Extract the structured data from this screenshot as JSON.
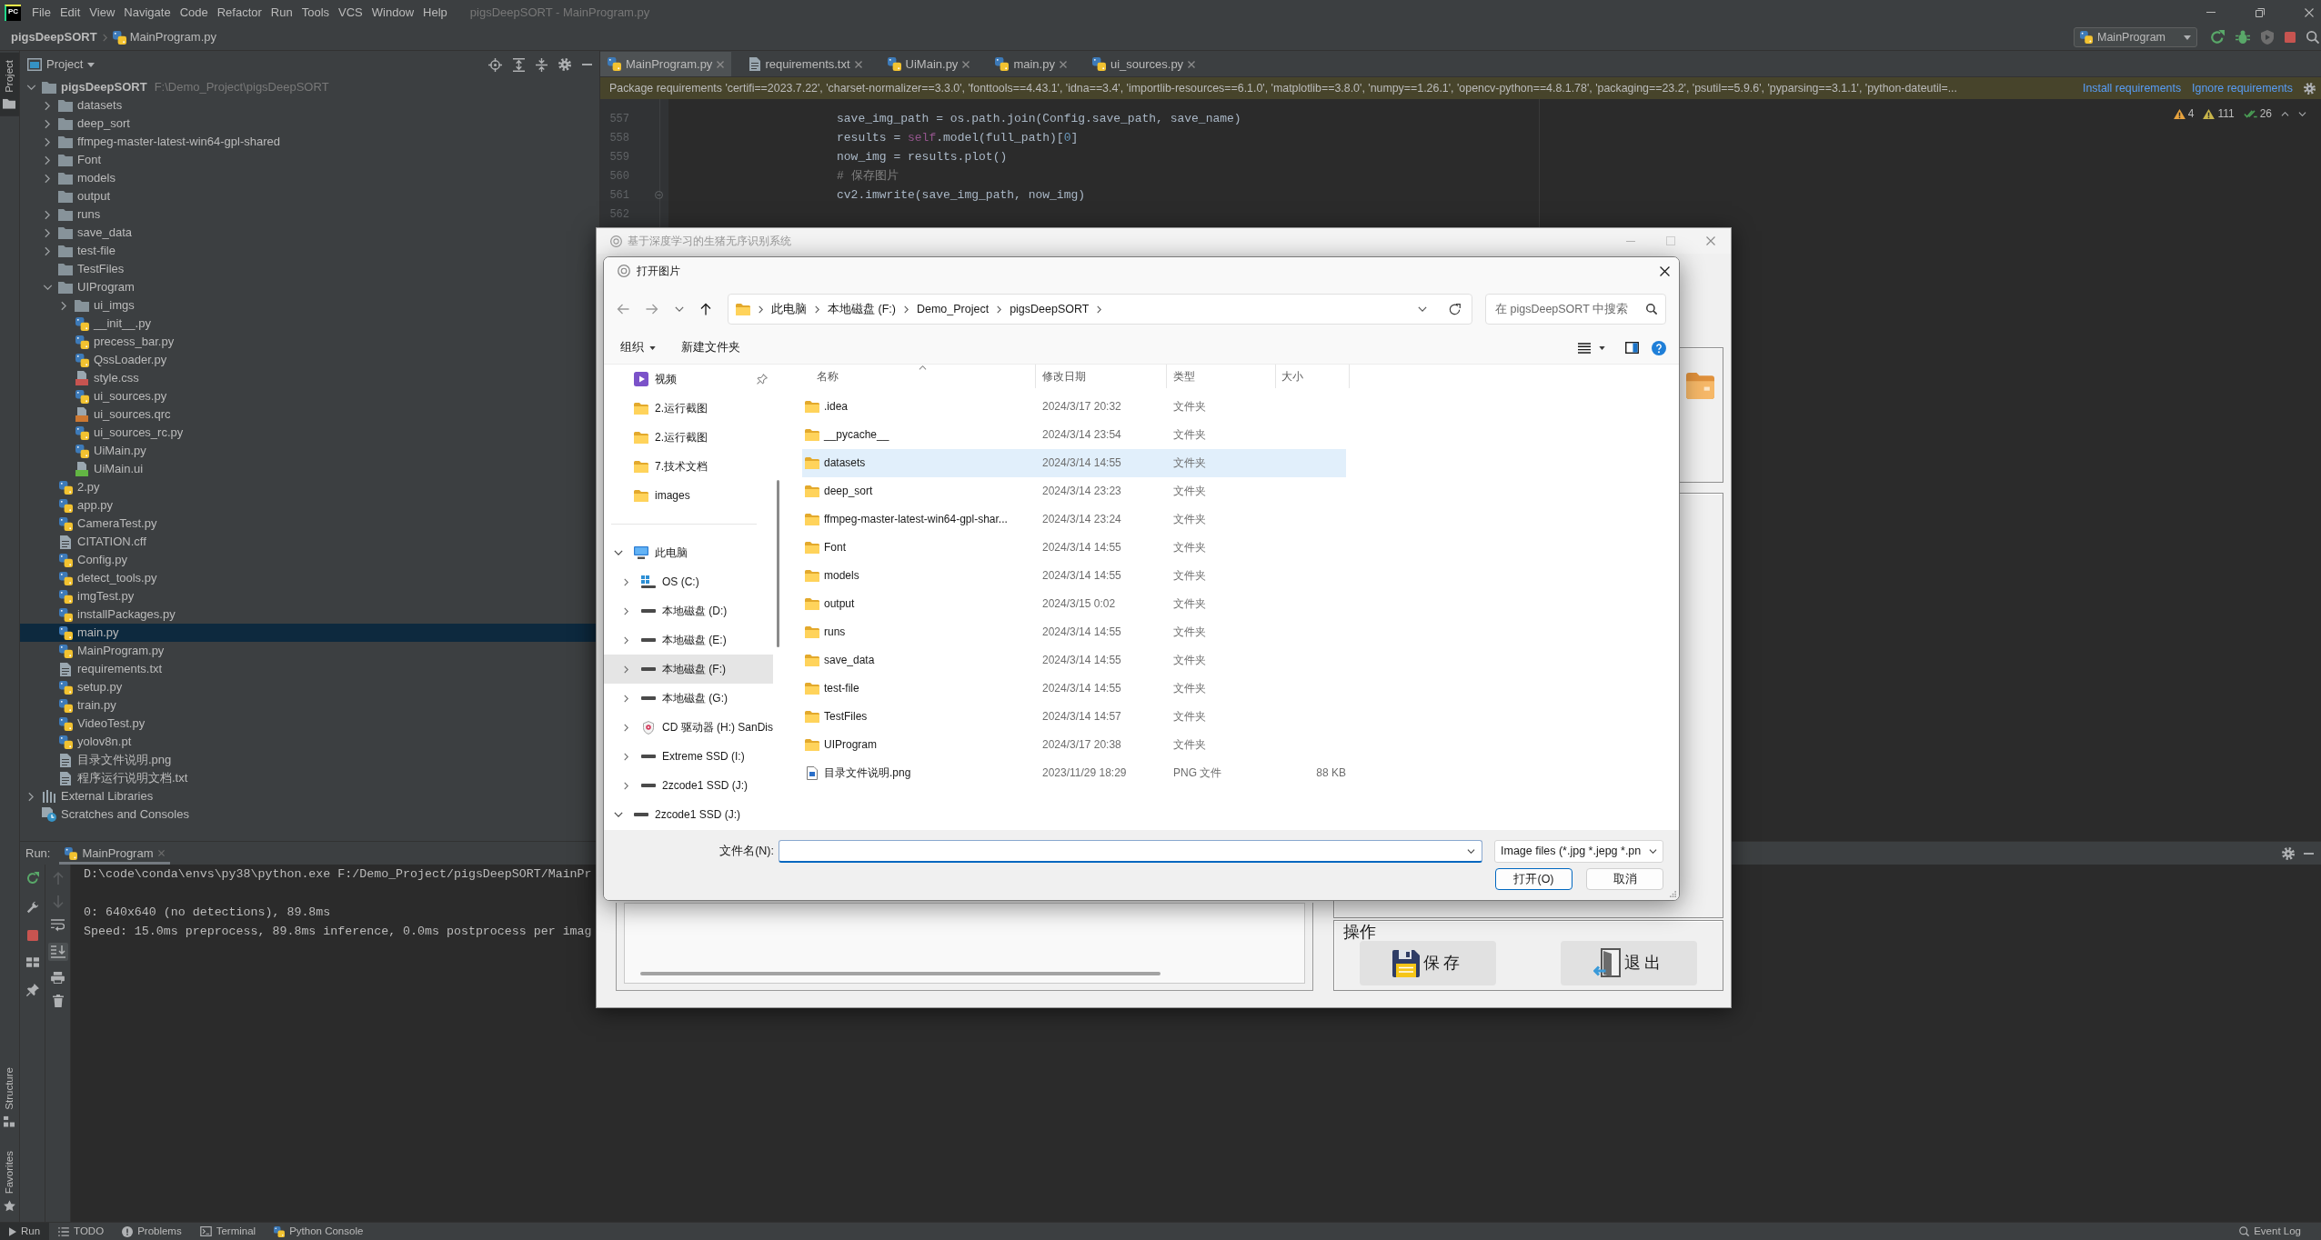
{
  "ide": {
    "logo": "PC",
    "menu": [
      "File",
      "Edit",
      "View",
      "Navigate",
      "Code",
      "Refactor",
      "Run",
      "Tools",
      "VCS",
      "Window",
      "Help"
    ],
    "title": "pigsDeepSORT - MainProgram.py",
    "breadcrumb": [
      {
        "label": "pigsDeepSORT",
        "kind": "project"
      },
      {
        "label": "MainProgram.py",
        "kind": "python"
      }
    ],
    "run_config": "MainProgram",
    "side_tabs_top": [
      {
        "label": "Project",
        "kind": "project",
        "selected": true
      }
    ],
    "side_tabs_bottom": [
      {
        "label": "Structure",
        "kind": "structure",
        "selected": false
      },
      {
        "label": "Favorites",
        "kind": "favorites",
        "selected": false
      }
    ],
    "project": {
      "title": "Project",
      "tree": [
        {
          "label": "pigsDeepSORT",
          "path": "F:\\Demo_Project\\pigsDeepSORT",
          "kind": "folder",
          "expanded": true,
          "selected": false,
          "children": [
            {
              "label": "datasets",
              "kind": "folder",
              "expanded": false,
              "selected": false
            },
            {
              "label": "deep_sort",
              "kind": "folder",
              "expanded": false,
              "selected": false
            },
            {
              "label": "ffmpeg-master-latest-win64-gpl-shared",
              "kind": "folder",
              "expanded": false,
              "selected": false
            },
            {
              "label": "Font",
              "kind": "folder",
              "expanded": false,
              "selected": false
            },
            {
              "label": "models",
              "kind": "folder",
              "expanded": false,
              "selected": false
            },
            {
              "label": "output",
              "kind": "folder",
              "selected": false
            },
            {
              "label": "runs",
              "kind": "folder",
              "expanded": false,
              "selected": false
            },
            {
              "label": "save_data",
              "kind": "folder",
              "expanded": false,
              "selected": false
            },
            {
              "label": "test-file",
              "kind": "folder",
              "expanded": false,
              "selected": false
            },
            {
              "label": "TestFiles",
              "kind": "folder",
              "selected": false
            },
            {
              "label": "UIProgram",
              "kind": "folder",
              "expanded": true,
              "selected": false,
              "children": [
                {
                  "label": "ui_imgs",
                  "kind": "folder",
                  "expanded": false,
                  "selected": false
                },
                {
                  "label": "__init__.py",
                  "kind": "python",
                  "selected": false
                },
                {
                  "label": "precess_bar.py",
                  "kind": "python",
                  "selected": false
                },
                {
                  "label": "QssLoader.py",
                  "kind": "python",
                  "selected": false
                },
                {
                  "label": "style.css",
                  "kind": "css",
                  "selected": false
                },
                {
                  "label": "ui_sources.py",
                  "kind": "python",
                  "selected": false
                },
                {
                  "label": "ui_sources.qrc",
                  "kind": "qrc",
                  "selected": false
                },
                {
                  "label": "ui_sources_rc.py",
                  "kind": "python",
                  "selected": false
                },
                {
                  "label": "UiMain.py",
                  "kind": "python",
                  "selected": false
                },
                {
                  "label": "UiMain.ui",
                  "kind": "ui",
                  "selected": false
                }
              ]
            },
            {
              "label": "2.py",
              "kind": "python",
              "selected": false
            },
            {
              "label": "app.py",
              "kind": "python",
              "selected": false
            },
            {
              "label": "CameraTest.py",
              "kind": "python",
              "selected": false
            },
            {
              "label": "CITATION.cff",
              "kind": "text",
              "selected": false
            },
            {
              "label": "Config.py",
              "kind": "python",
              "selected": false
            },
            {
              "label": "detect_tools.py",
              "kind": "python",
              "selected": false
            },
            {
              "label": "imgTest.py",
              "kind": "python",
              "selected": false
            },
            {
              "label": "installPackages.py",
              "kind": "python",
              "selected": false
            },
            {
              "label": "main.py",
              "kind": "python",
              "selected": true
            },
            {
              "label": "MainProgram.py",
              "kind": "python",
              "selected": false
            },
            {
              "label": "requirements.txt",
              "kind": "text",
              "selected": false
            },
            {
              "label": "setup.py",
              "kind": "python",
              "selected": false
            },
            {
              "label": "train.py",
              "kind": "python",
              "selected": false
            },
            {
              "label": "VideoTest.py",
              "kind": "python",
              "selected": false
            },
            {
              "label": "yolov8n.pt",
              "kind": "model",
              "selected": false
            },
            {
              "label": "目录文件说明.png",
              "kind": "text",
              "selected": false
            },
            {
              "label": "程序运行说明文档.txt",
              "kind": "text",
              "selected": false
            }
          ]
        },
        {
          "label": "External Libraries",
          "kind": "libraries",
          "expanded": false,
          "selected": false
        },
        {
          "label": "Scratches and Consoles",
          "kind": "scratches",
          "selected": false
        }
      ]
    },
    "editor": {
      "tabs": [
        {
          "label": "MainProgram.py",
          "kind": "python",
          "selected": true
        },
        {
          "label": "requirements.txt",
          "kind": "text",
          "selected": false
        },
        {
          "label": "UiMain.py",
          "kind": "python",
          "selected": false
        },
        {
          "label": "main.py",
          "kind": "python",
          "selected": false
        },
        {
          "label": "ui_sources.py",
          "kind": "python",
          "selected": false
        }
      ],
      "notification": {
        "text": "Package requirements 'certifi==2023.7.22', 'charset-normalizer==3.3.0', 'fonttools==4.43.1', 'idna==3.4', 'importlib-resources==6.1.0', 'matplotlib==3.8.0', 'numpy==1.26.1', 'opencv-python==4.8.1.78', 'packaging==23.2', 'psutil==5.9.6', 'pyparsing==3.1.1', 'python-dateutil=...",
        "links": [
          "Install requirements",
          "Ignore requirements"
        ]
      },
      "inspections": [
        {
          "kind": "warning",
          "count": "4"
        },
        {
          "kind": "weak_warning",
          "count": "111"
        },
        {
          "kind": "typo",
          "count": "26"
        }
      ],
      "lines": [
        {
          "number": "557",
          "fold_marker": false,
          "tokens": [
            {
              "text": "save_img_path = os.path.join(Config.save_path, save_name)",
              "kind": "plain"
            }
          ]
        },
        {
          "number": "558",
          "fold_marker": false,
          "tokens": [
            {
              "text": "results = ",
              "kind": "plain"
            },
            {
              "text": "self",
              "kind": "self"
            },
            {
              "text": ".model(full_path)[",
              "kind": "plain"
            },
            {
              "text": "0",
              "kind": "number"
            },
            {
              "text": "]",
              "kind": "plain"
            }
          ]
        },
        {
          "number": "559",
          "fold_marker": false,
          "tokens": [
            {
              "text": "now_img = results.plot()",
              "kind": "plain"
            }
          ]
        },
        {
          "number": "560",
          "fold_marker": false,
          "tokens": [
            {
              "text": "# 保存图片",
              "kind": "comment"
            }
          ]
        },
        {
          "number": "561",
          "fold_marker": true,
          "tokens": [
            {
              "text": "cv2.imwrite(save_img_path, now_img)",
              "kind": "plain"
            }
          ]
        },
        {
          "number": "562",
          "fold_marker": false
        }
      ]
    },
    "run": {
      "label": "Run:",
      "tabs": [
        {
          "label": "MainProgram",
          "selected": true
        }
      ],
      "console": [
        "D:\\code\\conda\\envs\\py38\\python.exe F:/Demo_Project/pigsDeepSORT/MainPr",
        "0: 640x640 (no detections), 89.8ms",
        "Speed: 15.0ms preprocess, 89.8ms inference, 0.0ms postprocess per imag"
      ]
    },
    "bottom_tabs": [
      {
        "label": "Run",
        "kind": "run",
        "selected": true
      },
      {
        "label": "TODO",
        "kind": "todo",
        "selected": false
      },
      {
        "label": "Problems",
        "kind": "problems",
        "selected": false
      },
      {
        "label": "Terminal",
        "kind": "terminal",
        "selected": false
      },
      {
        "label": "Python Console",
        "kind": "python_console",
        "selected": false
      }
    ],
    "event_log": "Event Log"
  },
  "app": {
    "title": "基于深度学习的生猪无序识别系统",
    "operations_title": "操作",
    "buttons": [
      {
        "label": "保存",
        "kind": "save"
      },
      {
        "label": "退出",
        "kind": "exit"
      }
    ]
  },
  "dialog": {
    "title": "打开图片",
    "address": [
      "此电脑",
      "本地磁盘 (F:)",
      "Demo_Project",
      "pigsDeepSORT"
    ],
    "search": {
      "placeholder": "在 pigsDeepSORT 中搜索"
    },
    "toolbar": [
      {
        "label": "组织",
        "kind": "menu"
      },
      {
        "label": "新建文件夹",
        "kind": "button"
      }
    ],
    "quick_access": [
      {
        "label": "视频",
        "kind": "video",
        "pinned": true,
        "selected": false
      },
      {
        "label": "2.运行截图",
        "kind": "folder",
        "pinned": false,
        "selected": false
      },
      {
        "label": "2.运行截图",
        "kind": "folder",
        "pinned": false,
        "selected": false
      },
      {
        "label": "7.技术文档",
        "kind": "folder",
        "pinned": false,
        "selected": false
      },
      {
        "label": "images",
        "kind": "folder",
        "pinned": false,
        "selected": false
      }
    ],
    "tree": [
      {
        "label": "此电脑",
        "kind": "pc",
        "expanded": true,
        "selected": false,
        "children": [
          {
            "label": "OS (C:)",
            "kind": "os_drive",
            "expanded": false,
            "selected": false
          },
          {
            "label": "本地磁盘 (D:)",
            "kind": "drive",
            "expanded": false,
            "selected": false
          },
          {
            "label": "本地磁盘 (E:)",
            "kind": "drive",
            "expanded": false,
            "selected": false
          },
          {
            "label": "本地磁盘 (F:)",
            "kind": "drive",
            "expanded": false,
            "selected": true
          },
          {
            "label": "本地磁盘 (G:)",
            "kind": "drive",
            "expanded": false,
            "selected": false
          },
          {
            "label": "CD 驱动器 (H:) SanDis",
            "kind": "cd_drive",
            "expanded": false,
            "selected": false
          },
          {
            "label": "Extreme SSD (I:)",
            "kind": "drive",
            "expanded": false,
            "selected": false
          },
          {
            "label": "2zcode1 SSD (J:)",
            "kind": "drive",
            "expanded": false,
            "selected": false
          }
        ]
      },
      {
        "label": "2zcode1 SSD (J:)",
        "kind": "drive",
        "expanded": true,
        "selected": false
      }
    ],
    "columns": [
      {
        "label": "名称",
        "sorted": true
      },
      {
        "label": "修改日期",
        "sorted": false
      },
      {
        "label": "类型",
        "sorted": false
      },
      {
        "label": "大小",
        "sorted": false
      }
    ],
    "files": [
      {
        "name": ".idea",
        "date": "2024/3/17 20:32",
        "type": "文件夹",
        "kind": "folder",
        "selected": false
      },
      {
        "name": "__pycache__",
        "date": "2024/3/14 23:54",
        "type": "文件夹",
        "kind": "folder",
        "selected": false
      },
      {
        "name": "datasets",
        "date": "2024/3/14 14:55",
        "type": "文件夹",
        "kind": "folder",
        "selected": true
      },
      {
        "name": "deep_sort",
        "date": "2024/3/14 23:23",
        "type": "文件夹",
        "kind": "folder",
        "selected": false
      },
      {
        "name": "ffmpeg-master-latest-win64-gpl-shar...",
        "date": "2024/3/14 23:24",
        "type": "文件夹",
        "kind": "folder",
        "selected": false
      },
      {
        "name": "Font",
        "date": "2024/3/14 14:55",
        "type": "文件夹",
        "kind": "folder",
        "selected": false
      },
      {
        "name": "models",
        "date": "2024/3/14 14:55",
        "type": "文件夹",
        "kind": "folder",
        "selected": false
      },
      {
        "name": "output",
        "date": "2024/3/15 0:02",
        "type": "文件夹",
        "kind": "folder",
        "selected": false
      },
      {
        "name": "runs",
        "date": "2024/3/14 14:55",
        "type": "文件夹",
        "kind": "folder",
        "selected": false
      },
      {
        "name": "save_data",
        "date": "2024/3/14 14:55",
        "type": "文件夹",
        "kind": "folder",
        "selected": false
      },
      {
        "name": "test-file",
        "date": "2024/3/14 14:55",
        "type": "文件夹",
        "kind": "folder",
        "selected": false
      },
      {
        "name": "TestFiles",
        "date": "2024/3/14 14:57",
        "type": "文件夹",
        "kind": "folder",
        "selected": false
      },
      {
        "name": "UIProgram",
        "date": "2024/3/17 20:38",
        "type": "文件夹",
        "kind": "folder",
        "selected": false
      },
      {
        "name": "目录文件说明.png",
        "date": "2023/11/29 18:29",
        "type": "PNG 文件",
        "size": "88 KB",
        "kind": "image",
        "selected": false
      }
    ],
    "filename_label": "文件名(N):",
    "filter": "Image files (*.jpg *.jepg *.pn",
    "buttons": [
      {
        "label": "打开(O)",
        "kind": "primary"
      },
      {
        "label": "取消",
        "kind": "secondary"
      }
    ]
  }
}
